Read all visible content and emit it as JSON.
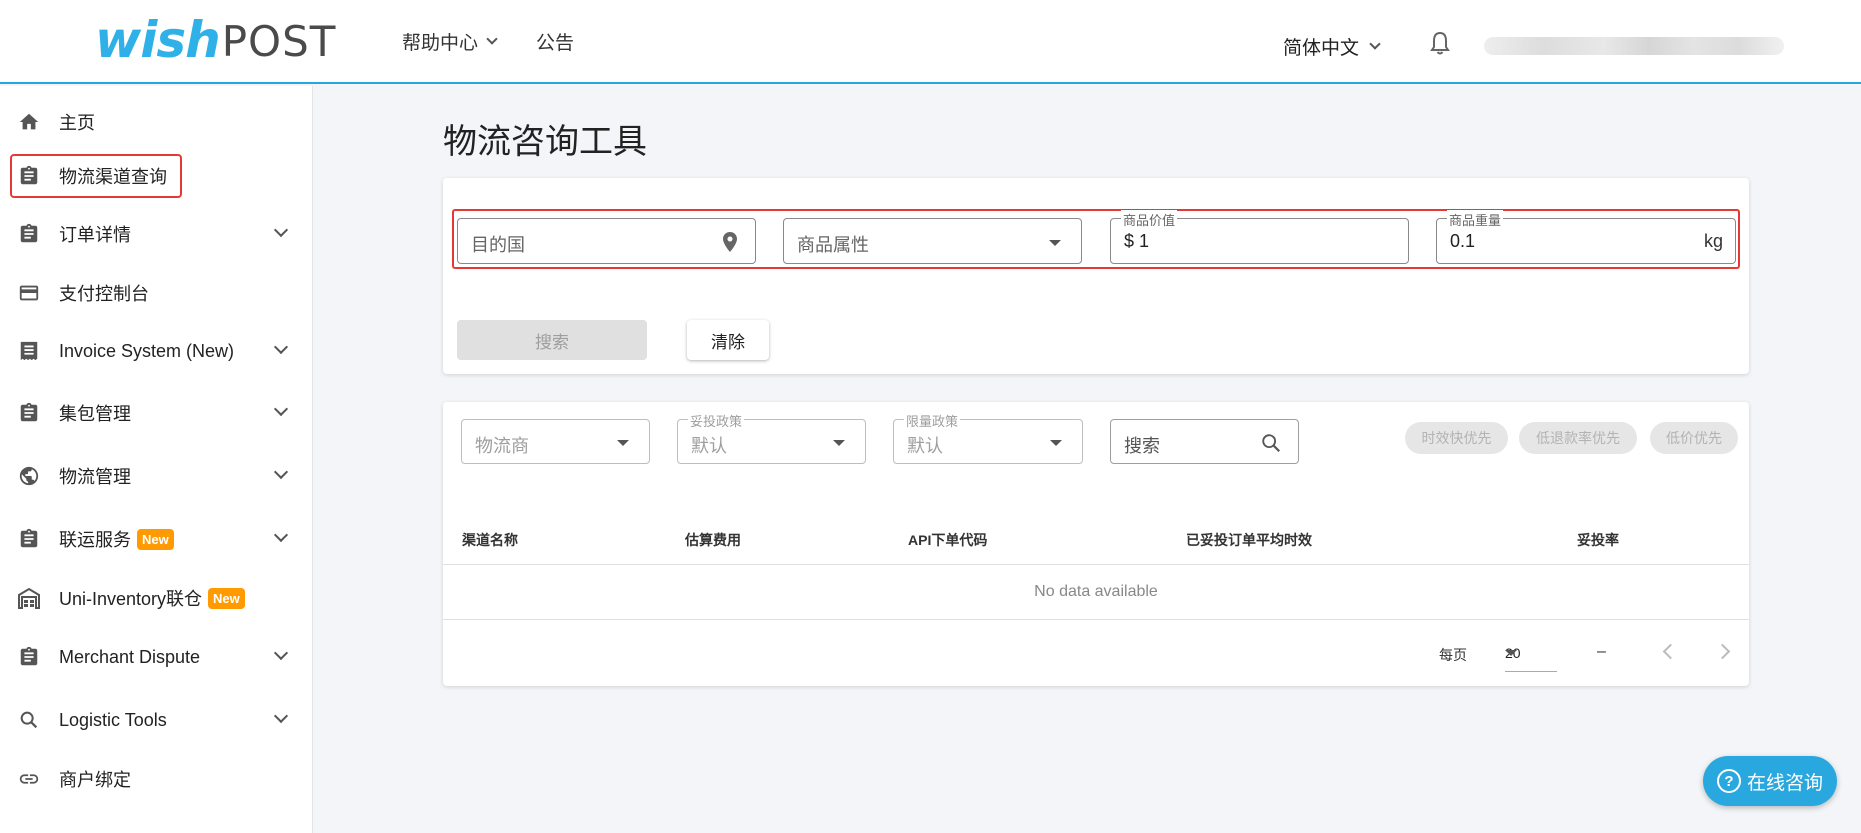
{
  "header": {
    "logo_wish": "wish",
    "logo_post": "POST",
    "nav": [
      {
        "label": "帮助中心",
        "has_dropdown": true
      },
      {
        "label": "公告",
        "has_dropdown": false
      }
    ],
    "language": "简体中文",
    "accent_color": "#27a7e0"
  },
  "sidebar": {
    "items": [
      {
        "label": "主页",
        "icon": "home-icon",
        "expandable": false
      },
      {
        "label": "物流渠道查询",
        "icon": "clipboard-icon",
        "expandable": false,
        "highlighted": true
      },
      {
        "label": "订单详情",
        "icon": "clipboard-icon",
        "expandable": true
      },
      {
        "label": "支付控制台",
        "icon": "credit-card-icon",
        "expandable": false
      },
      {
        "label": "Invoice System (New)",
        "icon": "receipt-icon",
        "expandable": true
      },
      {
        "label": "集包管理",
        "icon": "clipboard-icon",
        "expandable": true
      },
      {
        "label": "物流管理",
        "icon": "globe-icon",
        "expandable": true
      },
      {
        "label": "联运服务",
        "icon": "clipboard-icon",
        "expandable": true,
        "badge": "New"
      },
      {
        "label": "Uni-Inventory联仓",
        "icon": "warehouse-icon",
        "expandable": false,
        "badge": "New"
      },
      {
        "label": "Merchant Dispute",
        "icon": "clipboard-icon",
        "expandable": true
      },
      {
        "label": "Logistic Tools",
        "icon": "search-icon",
        "expandable": true
      },
      {
        "label": "商户绑定",
        "icon": "link-icon",
        "expandable": false
      }
    ]
  },
  "main": {
    "title": "物流咨询工具",
    "query": {
      "destination_placeholder": "目的国",
      "attribute_placeholder": "商品属性",
      "value_label": "商品价值",
      "value": "$ 1",
      "weight_label": "商品重量",
      "weight": "0.1",
      "weight_unit": "kg",
      "search_button": "搜索",
      "clear_button": "清除"
    },
    "filters": {
      "carrier_placeholder": "物流商",
      "delivery_policy_label": "妥投政策",
      "delivery_policy_value": "默认",
      "limit_policy_label": "限量政策",
      "limit_policy_value": "默认",
      "search_placeholder": "搜索",
      "chips": [
        "时效快优先",
        "低退款率优先",
        "低价优先"
      ]
    },
    "table": {
      "columns": [
        "渠道名称",
        "估算费用",
        "API下单代码",
        "已妥投订单平均时效",
        "妥投率"
      ],
      "empty_text": "No data available",
      "per_page_label": "每页",
      "per_page_value": "20",
      "range_text": "–"
    }
  },
  "consult_button": "在线咨询"
}
